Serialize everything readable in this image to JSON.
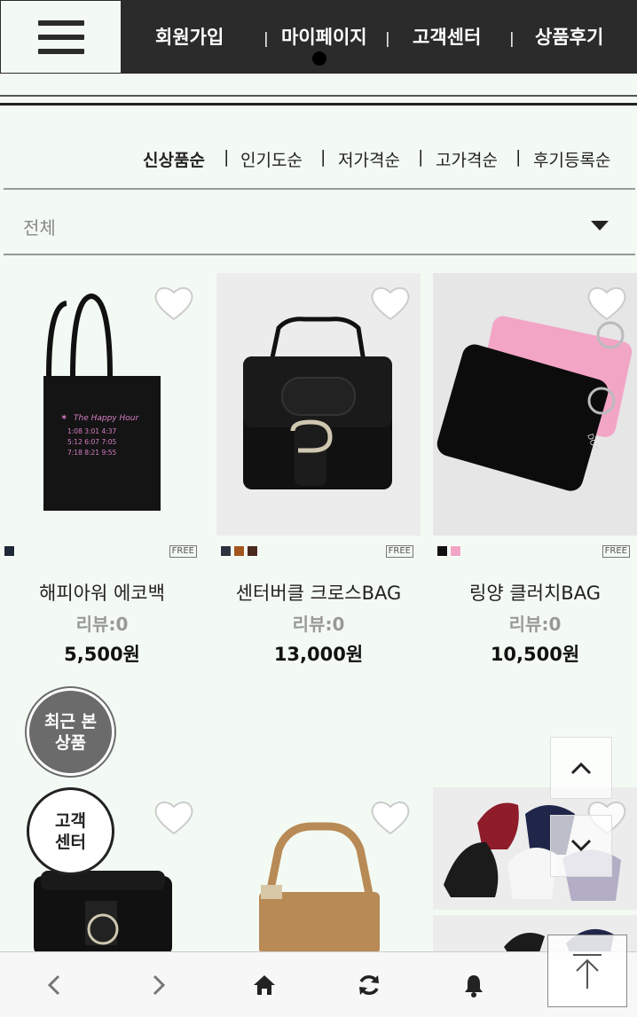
{
  "header": {
    "menu_icon": "hamburger-icon",
    "nav": [
      "회원가입",
      "마이페이지",
      "고객센터",
      "상품후기"
    ]
  },
  "sort": {
    "options": [
      "신상품순",
      "인기도순",
      "저가격순",
      "고가격순",
      "후기등록순"
    ],
    "active": "신상품순"
  },
  "filter": {
    "value": "전체"
  },
  "products": [
    {
      "name": "해피아워 에코백",
      "review": "리뷰:0",
      "price": "5,500원",
      "free": "FREE",
      "colors": [
        "#1e2a38"
      ]
    },
    {
      "name": "센터버클 크로스BAG",
      "review": "리뷰:0",
      "price": "13,000원",
      "free": "FREE",
      "colors": [
        "#2c3440",
        "#a3561e",
        "#4a2a1e"
      ]
    },
    {
      "name": "링양 클러치BAG",
      "review": "리뷰:0",
      "price": "10,500원",
      "free": "FREE",
      "colors": [
        "#111111",
        "#f0a6c4"
      ]
    }
  ],
  "floating": {
    "recent_line1": "최근 본",
    "recent_line2": "상품",
    "cs_line1": "고객",
    "cs_line2": "센터"
  },
  "colors": {
    "header_bg": "#2b2b2b",
    "page_bg": "#f3faf3"
  }
}
